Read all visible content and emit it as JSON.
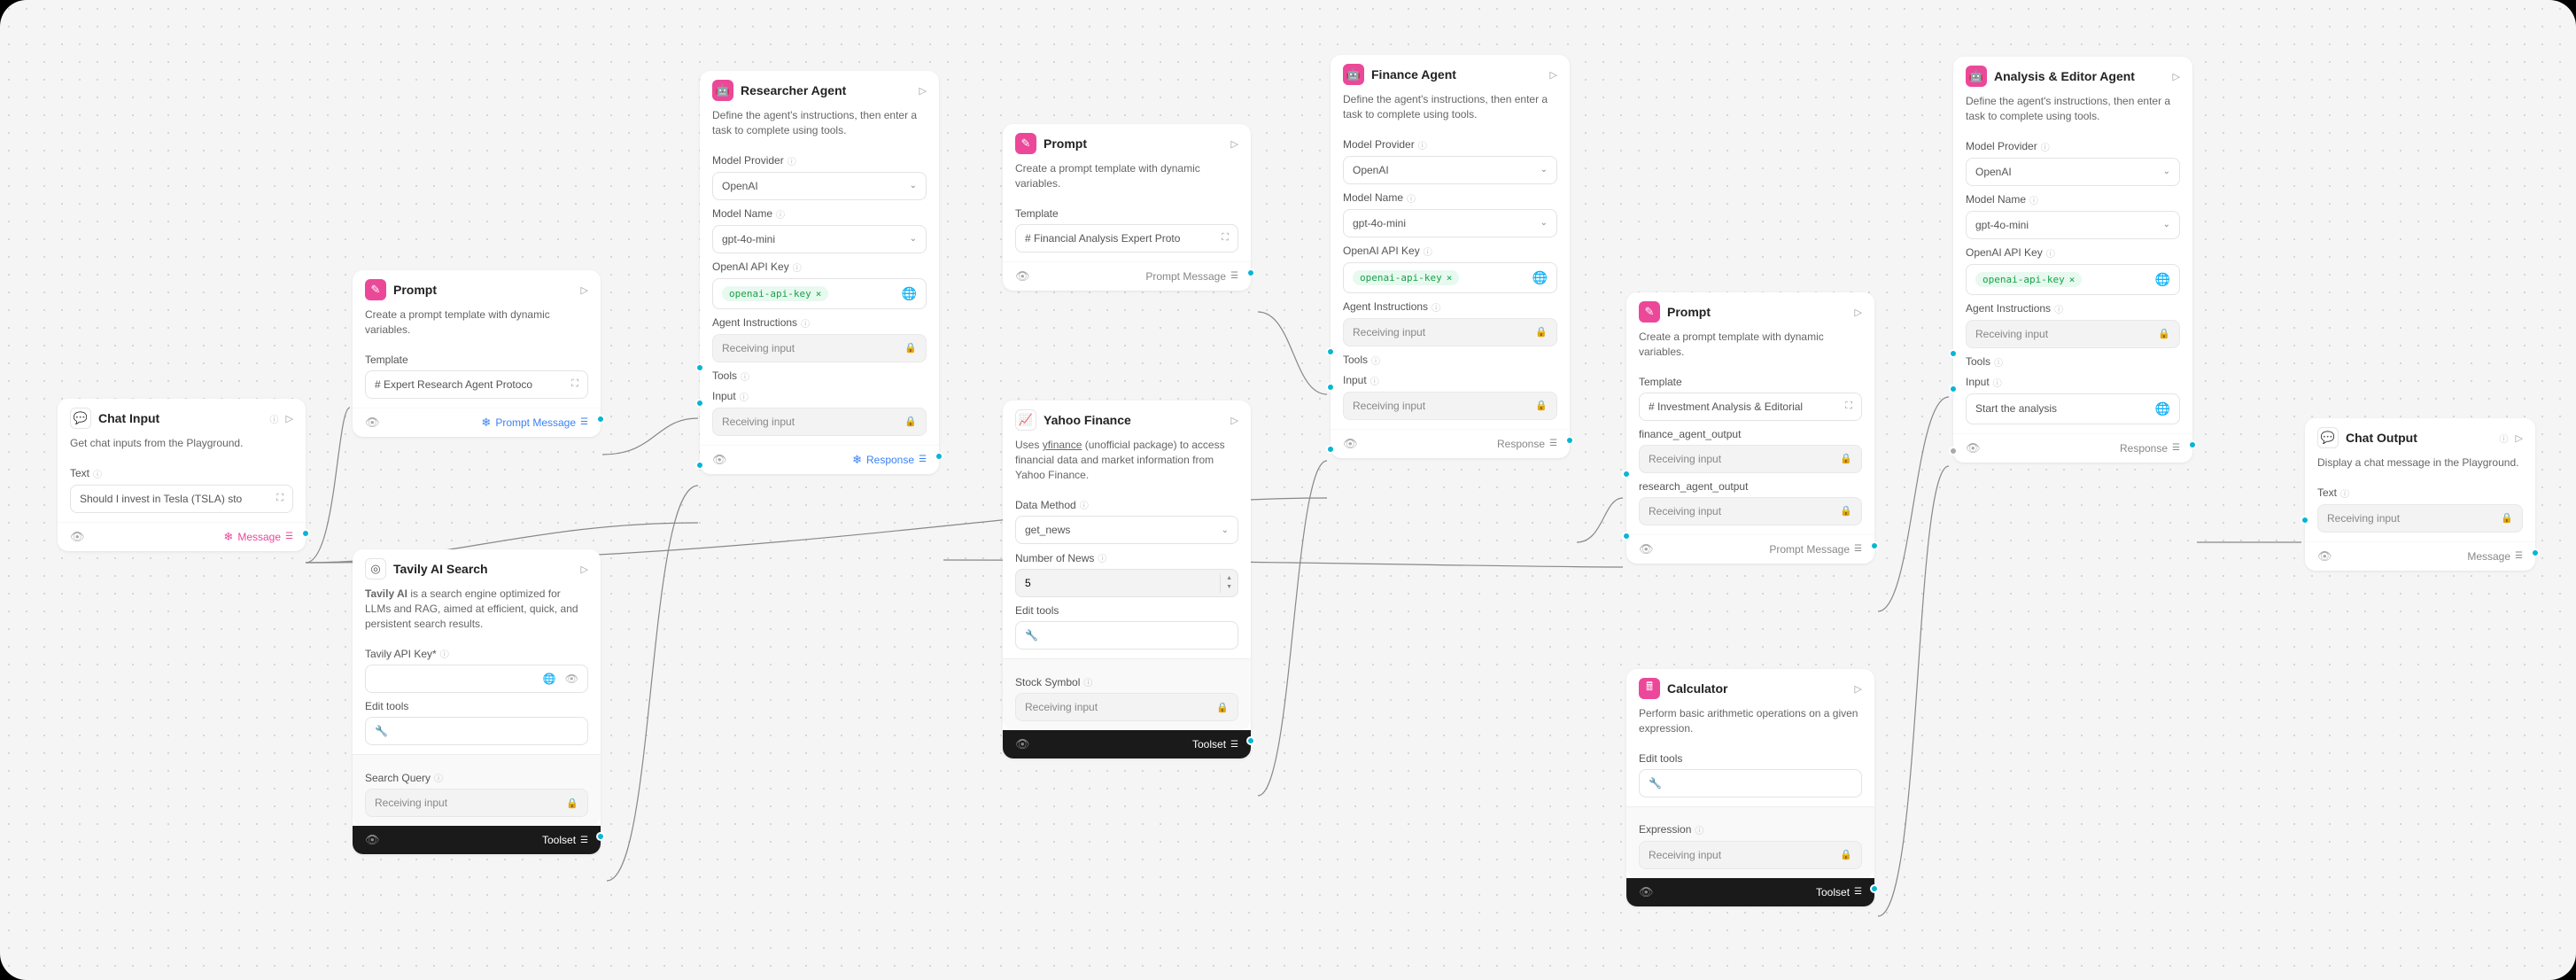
{
  "nodes": {
    "chat_input": {
      "title": "Chat Input",
      "desc": "Get chat inputs from the Playground.",
      "text_label": "Text",
      "text_value": "Should I invest in Tesla (TSLA) sto",
      "footer": "Message"
    },
    "prompt1": {
      "title": "Prompt",
      "desc": "Create a prompt template with dynamic variables.",
      "template_label": "Template",
      "template_value": "# Expert Research Agent Protoco",
      "footer": "Prompt Message"
    },
    "tavily": {
      "title": "Tavily AI Search",
      "desc_prefix": "Tavily AI",
      "desc_rest": " is a search engine optimized for LLMs and RAG, aimed at efficient, quick, and persistent search results.",
      "api_key_label": "Tavily API Key*",
      "edit_tools_label": "Edit tools",
      "search_query_label": "Search Query",
      "receiving": "Receiving input",
      "footer": "Toolset"
    },
    "researcher": {
      "title": "Researcher Agent",
      "desc": "Define the agent's instructions, then enter a task to complete using tools.",
      "model_provider_label": "Model Provider",
      "model_provider": "OpenAI",
      "model_name_label": "Model Name",
      "model_name": "gpt-4o-mini",
      "api_key_label": "OpenAI API Key",
      "api_key_tag": "openai-api-key",
      "instructions_label": "Agent Instructions",
      "tools_label": "Tools",
      "input_label": "Input",
      "receiving": "Receiving input",
      "footer": "Response"
    },
    "prompt2": {
      "title": "Prompt",
      "desc": "Create a prompt template with dynamic variables.",
      "template_label": "Template",
      "template_value": "# Financial Analysis Expert Proto",
      "footer": "Prompt Message"
    },
    "yahoo": {
      "title": "Yahoo Finance",
      "desc_pre": "Uses ",
      "desc_link": "yfinance",
      "desc_post": " (unofficial package) to access financial data and market information from Yahoo Finance.",
      "data_method_label": "Data Method",
      "data_method": "get_news",
      "num_news_label": "Number of News",
      "num_news": "5",
      "edit_tools_label": "Edit tools",
      "stock_label": "Stock Symbol",
      "receiving": "Receiving input",
      "footer": "Toolset"
    },
    "finance": {
      "title": "Finance Agent",
      "desc": "Define the agent's instructions, then enter a task to complete using tools.",
      "model_provider_label": "Model Provider",
      "model_provider": "OpenAI",
      "model_name_label": "Model Name",
      "model_name": "gpt-4o-mini",
      "api_key_label": "OpenAI API Key",
      "api_key_tag": "openai-api-key",
      "instructions_label": "Agent Instructions",
      "tools_label": "Tools",
      "input_label": "Input",
      "receiving": "Receiving input",
      "footer": "Response"
    },
    "prompt3": {
      "title": "Prompt",
      "desc": "Create a prompt template with dynamic variables.",
      "template_label": "Template",
      "template_value": "# Investment Analysis & Editorial",
      "fin_out_label": "finance_agent_output",
      "res_out_label": "research_agent_output",
      "receiving": "Receiving input",
      "footer": "Prompt Message"
    },
    "calculator": {
      "title": "Calculator",
      "desc": "Perform basic arithmetic operations on a given expression.",
      "edit_tools_label": "Edit tools",
      "expression_label": "Expression",
      "receiving": "Receiving input",
      "footer": "Toolset"
    },
    "analysis": {
      "title": "Analysis & Editor Agent",
      "desc": "Define the agent's instructions, then enter a task to complete using tools.",
      "model_provider_label": "Model Provider",
      "model_provider": "OpenAI",
      "model_name_label": "Model Name",
      "model_name": "gpt-4o-mini",
      "api_key_label": "OpenAI API Key",
      "api_key_tag": "openai-api-key",
      "instructions_label": "Agent Instructions",
      "tools_label": "Tools",
      "input_label": "Input",
      "input_value": "Start the analysis",
      "receiving": "Receiving input",
      "footer": "Response"
    },
    "chat_output": {
      "title": "Chat Output",
      "desc": "Display a chat message in the Playground.",
      "text_label": "Text",
      "receiving": "Receiving input",
      "footer": "Message"
    }
  }
}
